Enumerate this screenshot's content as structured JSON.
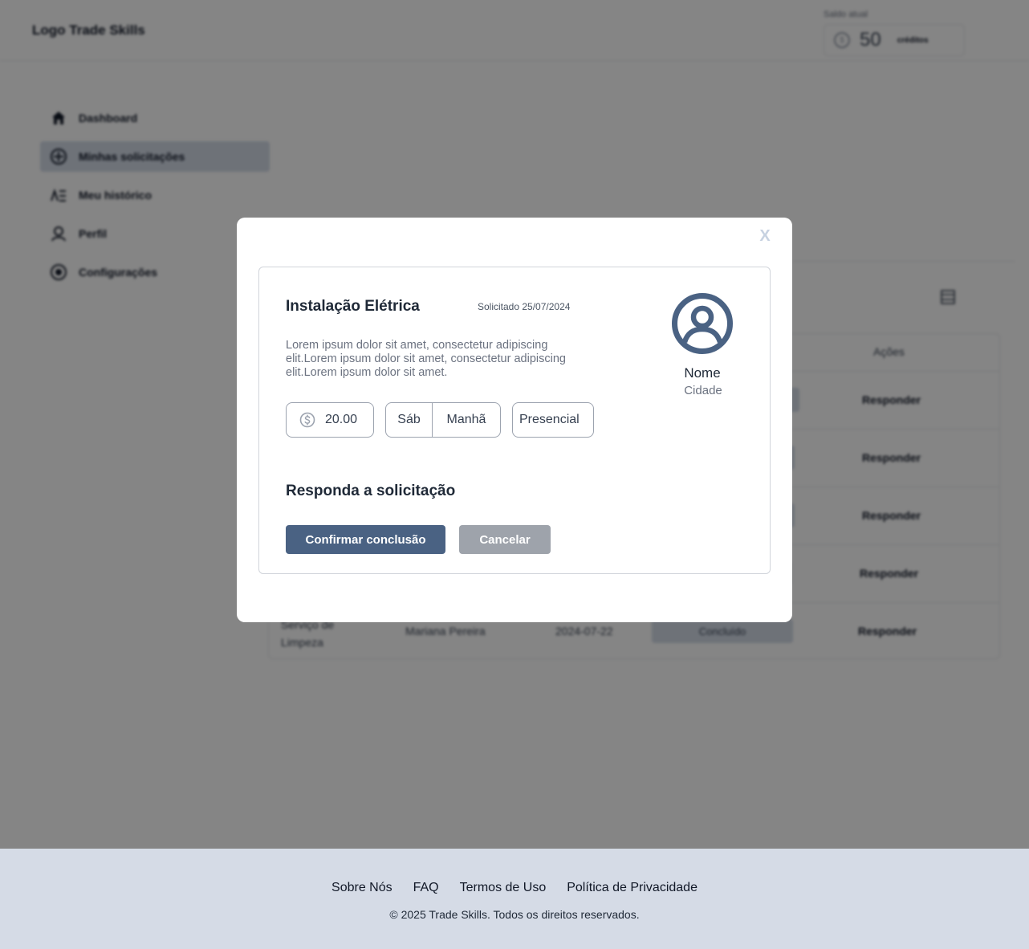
{
  "header": {
    "logo": "Logo Trade Skills",
    "balance_caption": "Saldo atual",
    "balance_amount": "50",
    "balance_unit": "créditos",
    "balance_icon": "coin-icon"
  },
  "sidebar": {
    "items": [
      {
        "label": "Dashboard",
        "icon": "home-icon",
        "active": false
      },
      {
        "label": "Minhas solicitações",
        "icon": "requests-icon",
        "active": true
      },
      {
        "label": "Meu histórico",
        "icon": "history-icon",
        "active": false
      },
      {
        "label": "Perfil",
        "icon": "user-icon",
        "active": false
      },
      {
        "label": "Configurações",
        "icon": "settings-icon",
        "active": false
      }
    ]
  },
  "table": {
    "actions_header": "Ações",
    "action_label": "Responder",
    "last_row": {
      "service": "Serviço de Limpeza",
      "client": "Mariana Pereira",
      "date": "2024-07-22",
      "status": "Concluído"
    }
  },
  "modal": {
    "close_label": "X",
    "request": {
      "title": "Instalação Elétrica",
      "requested_date": "Solicitado 25/07/2024",
      "description": "Lorem ipsum dolor sit amet, consectetur adipiscing elit.Lorem ipsum dolor sit amet, consectetur adipiscing elit.Lorem ipsum dolor sit amet.",
      "price": "20.00",
      "day": "Sáb",
      "period": "Manhã",
      "mode": "Presencial"
    },
    "provider": {
      "name": "Nome",
      "city": "Cidade"
    },
    "respond_title": "Responda a solicitação",
    "confirm_label": "Confirmar conclusão",
    "cancel_label": "Cancelar"
  },
  "footer": {
    "links": [
      "Sobre Nós",
      "FAQ",
      "Termos de Uso",
      "Política de Privacidade"
    ],
    "copyright": "© 2025 Trade Skills. Todos os direitos reservados."
  },
  "colors": {
    "primary": "#4a6283",
    "cancel": "#9ea3ab",
    "footer_bg": "#d5dbe6",
    "sidebar_active": "#d3dbe7"
  }
}
